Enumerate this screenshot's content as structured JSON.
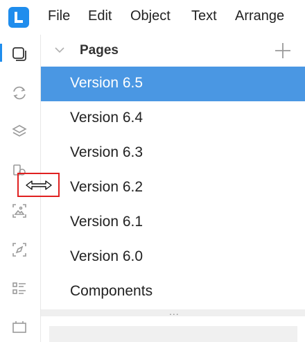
{
  "menu": {
    "items": [
      "File",
      "Edit",
      "Object",
      "Text",
      "Arrange"
    ]
  },
  "rail": {
    "icons": [
      "pages-icon",
      "sync-icon",
      "layers-icon",
      "components-icon",
      "image-icon",
      "pen-icon",
      "list-icon",
      "frame-icon"
    ]
  },
  "pages_panel": {
    "title": "Pages",
    "pages": [
      {
        "label": "Version 6.5",
        "selected": true
      },
      {
        "label": "Version 6.4",
        "selected": false
      },
      {
        "label": "Version 6.3",
        "selected": false
      },
      {
        "label": "Version 6.2",
        "selected": false
      },
      {
        "label": "Version 6.1",
        "selected": false
      },
      {
        "label": "Version 6.0",
        "selected": false
      },
      {
        "label": "Components",
        "selected": false
      }
    ],
    "splitter_text": "..."
  },
  "colors": {
    "accent": "#1f8ded",
    "selected_row": "#4a97e3",
    "highlight_box": "#e02020"
  }
}
